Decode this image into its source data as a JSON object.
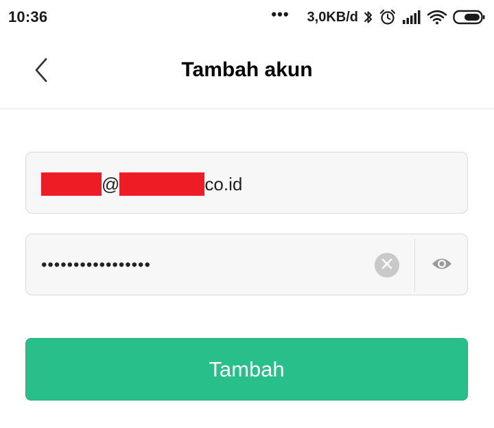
{
  "status_bar": {
    "time": "10:36",
    "dots": "•••",
    "network_speed": "3,0KB/d",
    "icons": [
      "bluetooth-icon",
      "alarm-icon",
      "signal-icon",
      "wifi-icon",
      "battery-icon"
    ]
  },
  "header": {
    "back_icon": "chevron-left-icon",
    "title": "Tambah akun"
  },
  "form": {
    "email": {
      "value_separator": "@",
      "value_suffix": "co.id",
      "redacted": true
    },
    "password": {
      "masked_value": "•••••••••••••••••",
      "clear_icon": "clear-icon",
      "visibility_icon": "eye-icon"
    },
    "submit_label": "Tambah"
  },
  "colors": {
    "accent": "#29bf8b",
    "redaction": "#ee1c25",
    "field_background": "#f7f7f7",
    "field_border": "#d9d9d9"
  }
}
